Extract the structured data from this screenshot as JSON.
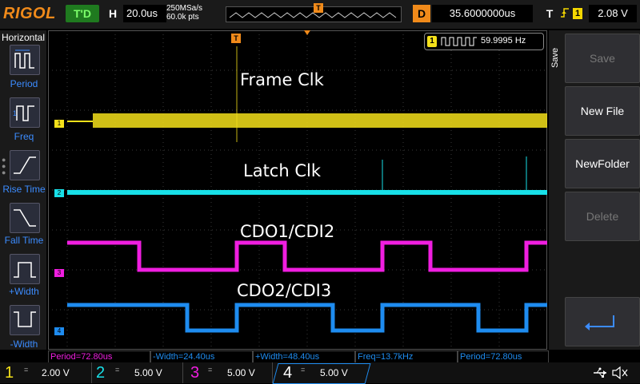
{
  "topbar": {
    "brand": "RIGOL",
    "run_status": "T'D",
    "horizontal_key": "H",
    "timebase": "20.0us",
    "sample_rate": "250MSa/s",
    "memory_depth": "60.0k pts",
    "trigger_marker": "T",
    "delay_key": "D",
    "delay_value": "35.6000000us",
    "trigger_key": "T",
    "trigger_source": "1",
    "trigger_level": "2.08 V"
  },
  "left_panel": {
    "title": "Horizontal",
    "items": [
      {
        "label": "Period"
      },
      {
        "label": "Freq"
      },
      {
        "label": "Rise Time"
      },
      {
        "label": "Fall Time"
      },
      {
        "label": "+Width"
      },
      {
        "label": "-Width"
      }
    ]
  },
  "screen": {
    "counter_channel": "1",
    "counter_value": "59.9995 Hz",
    "trigger_marker": "T",
    "traces": [
      {
        "name": "Frame Clk",
        "marker": "1",
        "color": "#f5e11a"
      },
      {
        "name": "Latch Clk",
        "marker": "2",
        "color": "#18e0e8"
      },
      {
        "name": "CDO1/CDI2",
        "marker": "3",
        "color": "#f01ee0"
      },
      {
        "name": "CDO2/CDI3",
        "marker": "4",
        "color": "#1e8cf0"
      }
    ]
  },
  "right_panel": {
    "tab_label": "Save",
    "buttons": [
      {
        "label": "Save",
        "enabled": false
      },
      {
        "label": "New File",
        "enabled": true
      },
      {
        "label": "NewFolder",
        "enabled": true
      },
      {
        "label": "Delete",
        "enabled": false
      }
    ]
  },
  "measurements": [
    {
      "text": "Period=72.80us",
      "color": "#f01ee0"
    },
    {
      "text": "-Width=24.40us",
      "color": "#1e8cf0"
    },
    {
      "text": "+Width=48.40us",
      "color": "#1e8cf0"
    },
    {
      "text": "Freq=13.7kHz",
      "color": "#1e8cf0"
    },
    {
      "text": "Period=72.80us",
      "color": "#1e8cf0"
    }
  ],
  "channels": [
    {
      "num": "1",
      "coupling": "=",
      "scale": "2.00 V",
      "color": "#f5e11a"
    },
    {
      "num": "2",
      "coupling": "=",
      "scale": "5.00 V",
      "color": "#18e0e8"
    },
    {
      "num": "3",
      "coupling": "=",
      "scale": "5.00 V",
      "color": "#f01ee0"
    },
    {
      "num": "4",
      "coupling": "=",
      "scale": "5.00 V",
      "color": "#1e8cf0"
    }
  ],
  "status_icons": [
    "usb-icon",
    "speaker-mute-icon"
  ]
}
